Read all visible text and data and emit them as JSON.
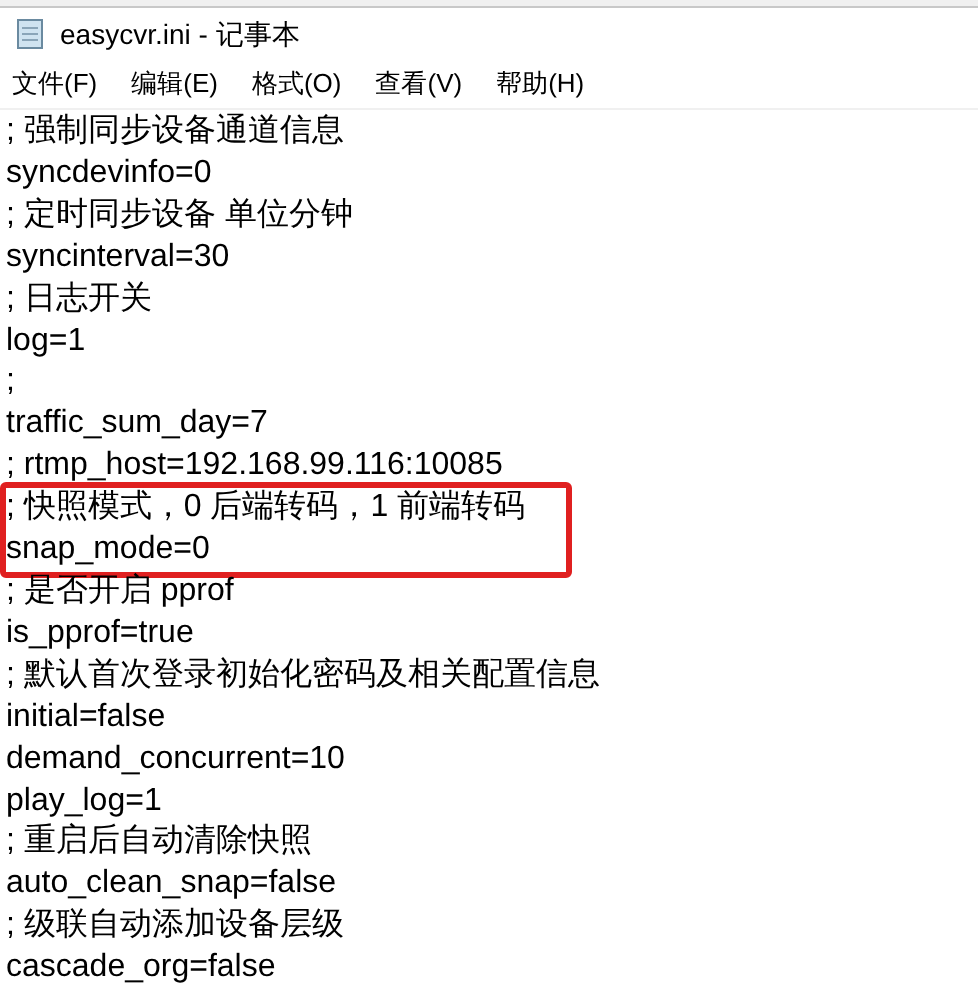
{
  "window": {
    "title": "easycvr.ini - 记事本"
  },
  "menu": [
    "文件(F)",
    "编辑(E)",
    "格式(O)",
    "查看(V)",
    "帮助(H)"
  ],
  "lines": [
    {
      "text": "; 强制同步设备通道信息",
      "highlighted": false
    },
    {
      "text": "syncdevinfo=0",
      "highlighted": false
    },
    {
      "text": "; 定时同步设备 单位分钟",
      "highlighted": false
    },
    {
      "text": "syncinterval=30",
      "highlighted": false
    },
    {
      "text": "; 日志开关",
      "highlighted": false
    },
    {
      "text": "log=1",
      "highlighted": false
    },
    {
      "text": ";",
      "highlighted": false
    },
    {
      "text": "traffic_sum_day=7",
      "highlighted": false
    },
    {
      "text": "; rtmp_host=192.168.99.116:10085",
      "highlighted": false
    },
    {
      "text": "; 快照模式，0 后端转码，1 前端转码",
      "highlighted": true
    },
    {
      "text": "snap_mode=0",
      "highlighted": true
    },
    {
      "text": "; 是否开启 pprof",
      "highlighted": false
    },
    {
      "text": "is_pprof=true",
      "highlighted": false
    },
    {
      "text": "; 默认首次登录初始化密码及相关配置信息",
      "highlighted": false
    },
    {
      "text": "initial=false",
      "highlighted": false
    },
    {
      "text": "demand_concurrent=10",
      "highlighted": false
    },
    {
      "text": "play_log=1",
      "highlighted": false
    },
    {
      "text": "; 重启后自动清除快照",
      "highlighted": false
    },
    {
      "text": "auto_clean_snap=false",
      "highlighted": false
    },
    {
      "text": "; 级联自动添加设备层级",
      "highlighted": false
    },
    {
      "text": "cascade_org=false",
      "highlighted": false
    }
  ]
}
